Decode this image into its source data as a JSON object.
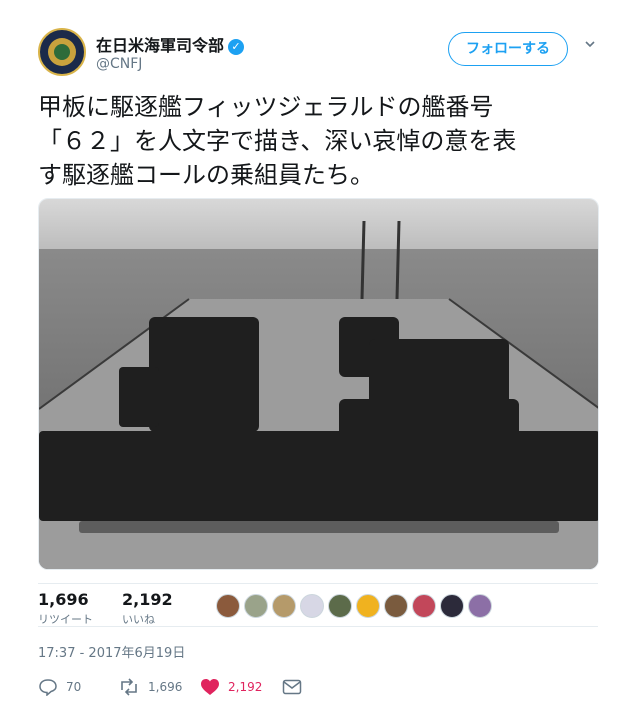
{
  "account": {
    "name": "在日米海軍司令部",
    "handle": "@CNFJ",
    "verified_mark": "✓",
    "follow_label": "フォローする"
  },
  "tweet": {
    "lines": [
      "甲板に駆逐艦フィッツジェラルドの艦番号",
      "「６２」を人文字で描き、深い哀悼の意を表",
      "す駆逐艦コールの乗組員たち。"
    ]
  },
  "photo": {
    "numeral": "62"
  },
  "stats": {
    "retweets": {
      "count": "1,696",
      "label": "リツイート"
    },
    "likes": {
      "count": "2,192",
      "label": "いいね"
    }
  },
  "likers": [
    {
      "icon": "avatar-1",
      "color": "#8b5a3c"
    },
    {
      "icon": "avatar-2",
      "color": "#9aa38a"
    },
    {
      "icon": "avatar-3",
      "color": "#b59a6a"
    },
    {
      "icon": "avatar-4",
      "color": "#d7d7e5"
    },
    {
      "icon": "avatar-5",
      "color": "#5c6b4a"
    },
    {
      "icon": "avatar-6",
      "color": "#f0b21f"
    },
    {
      "icon": "avatar-7",
      "color": "#7a5b3e"
    },
    {
      "icon": "avatar-8",
      "color": "#c2475a"
    },
    {
      "icon": "avatar-9",
      "color": "#2c2a3a"
    },
    {
      "icon": "avatar-10",
      "color": "#8c6fa6"
    }
  ],
  "timestamp": "17:37 - 2017年6月19日",
  "actions": {
    "reply_count": "70",
    "retweet_count": "1,696",
    "like_count": "2,192"
  },
  "colors": {
    "accent": "#1da1f2",
    "like": "#e0245e",
    "muted": "#657786"
  }
}
